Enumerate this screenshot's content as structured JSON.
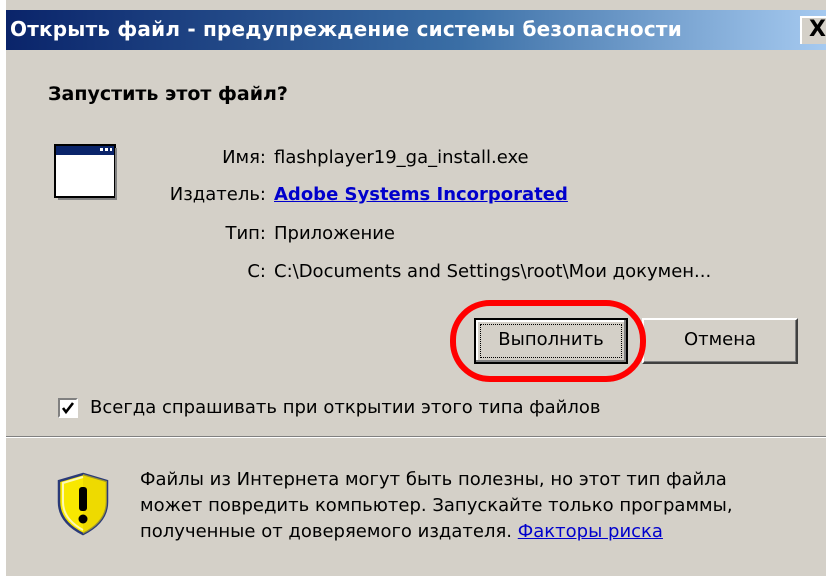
{
  "window": {
    "title": "Открыть файл - предупреждение системы безопасности",
    "close_label": "X"
  },
  "question": "Запустить этот файл?",
  "fields": {
    "name_label": "Имя:",
    "name_value": "flashplayer19_ga_install.exe",
    "publisher_label": "Издатель:",
    "publisher_value": "Adobe Systems Incorporated",
    "type_label": "Тип:",
    "type_value": "Приложение",
    "from_label": "С:",
    "from_value": "C:\\Documents and Settings\\root\\Мои докумен..."
  },
  "buttons": {
    "run_label": "Выполнить",
    "cancel_label": "Отмена"
  },
  "checkbox": {
    "checked": true,
    "label": "Всегда спрашивать при открытии этого типа файлов"
  },
  "warning": {
    "line1": "Файлы из Интернета могут быть полезны, но этот тип файла",
    "line2": "может повредить компьютер. Запускайте только программы,",
    "line3_prefix": "полученные от доверяемого издателя.",
    "risk_link": "Факторы риска"
  },
  "icons": {
    "app": "application-window-icon",
    "shield": "security-shield-warning-icon",
    "check": "checkmark-icon"
  },
  "colors": {
    "titlebar_start": "#0a246a",
    "titlebar_end": "#a6caf0",
    "link": "#0000cc",
    "highlight_oval": "#ff0000",
    "dialog_bg": "#d4d0c8"
  }
}
